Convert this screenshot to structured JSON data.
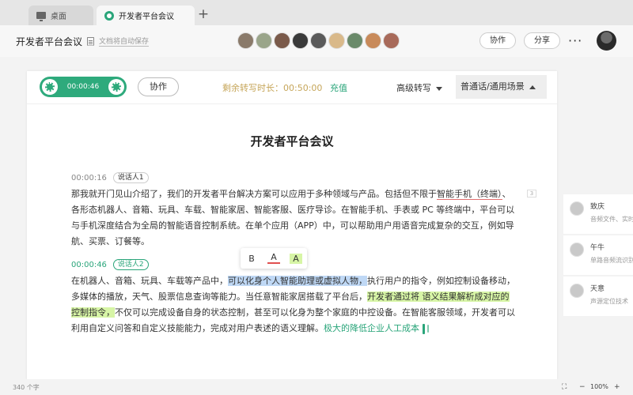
{
  "tabs": [
    {
      "label": "桌面",
      "icon": "monitor-icon"
    },
    {
      "label": "开发者平台会议",
      "icon": "app-logo-icon"
    }
  ],
  "header": {
    "doc_title": "开发者平台会议",
    "save_status": "文档将自动保存",
    "collab_label": "协作",
    "share_label": "分享",
    "more_label": "···"
  },
  "toolbar": {
    "rec_time": "00:00:46",
    "collab_label": "协作",
    "remaining": "剩余转写时长：00:50:00",
    "recharge": "充值",
    "advanced": "高级转写",
    "scene": "普通话/通用场景"
  },
  "doc": {
    "title": "开发者平台会议",
    "para_num": "3",
    "segments": [
      {
        "time": "00:00:16",
        "speaker": "说话人1",
        "p1": "那我就开门见山介绍了，我们的开发者平台解决方案可以应用于多种领域与产品。包括但不限于",
        "u1": "智能手机",
        "u2": "（终端）",
        "p2": "、各形态机器人、音箱、玩具、车载、智能家居、智能客服、医疗导诊。在智能手机、手表或 PC 等终端中，平台可以与手机深度结合为全局的智能语音控制系统。在单个应用（APP）中，可以帮助用户用语音完成复杂的交互，例如导航、买票、订餐等。"
      },
      {
        "time": "00:00:46",
        "speaker": "说话人2",
        "p1": "在机器人、音箱、玩具、车载等产品中，",
        "hl1": "可以化身个人智能助理或虚拟人物，",
        "p2": "执行用户的指令，例如控制设备移动，多媒体的播放，天气、股票信息查询等能力。当任意智能家居搭载了平台后，",
        "hl2": "开发者通过将 语义结果解析成对应的控制指令，",
        "p3": "不仅可以完成设备自身的状态控制，甚至可以化身为整个家庭的中控设备。在智能客服领域，开发者可以利用自定义问答和自定义技能能力，完成对用户表述的语义理解。",
        "live": "极大的降低企业人工成本"
      }
    ]
  },
  "format_popup": {
    "bold": "B",
    "color": "A",
    "highlight": "A"
  },
  "side_panel": [
    {
      "name": "致庆",
      "desc": "音频文件、实时"
    },
    {
      "name": "午牛",
      "desc": "单路音频流识别"
    },
    {
      "name": "天意",
      "desc": "声源定位技术"
    }
  ],
  "status": {
    "word_count": "340 个字",
    "zoom": "100%"
  }
}
